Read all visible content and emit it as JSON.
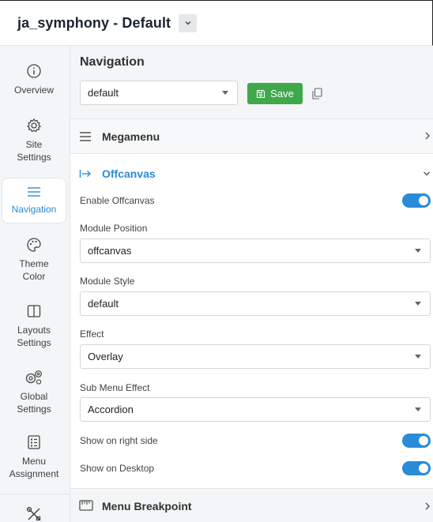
{
  "header": {
    "title": "ja_symphony - Default"
  },
  "sidebar": {
    "items": [
      {
        "label": "Overview"
      },
      {
        "label": "Site Settings"
      },
      {
        "label": "Navigation"
      },
      {
        "label": "Theme Color"
      },
      {
        "label": "Layouts Settings"
      },
      {
        "label": "Global Settings"
      },
      {
        "label": "Menu Assignment"
      }
    ]
  },
  "navigation": {
    "title": "Navigation",
    "preset_select": "default",
    "save_label": "Save"
  },
  "megamenu": {
    "label": "Megamenu"
  },
  "offcanvas": {
    "label": "Offcanvas",
    "enable_label": "Enable Offcanvas",
    "enable_on": true,
    "module_position": {
      "label": "Module Position",
      "value": "offcanvas"
    },
    "module_style": {
      "label": "Module Style",
      "value": "default"
    },
    "effect": {
      "label": "Effect",
      "value": "Overlay"
    },
    "sub_menu_effect": {
      "label": "Sub Menu Effect",
      "value": "Accordion"
    },
    "right_side": {
      "label": "Show on right side",
      "on": true
    },
    "desktop": {
      "label": "Show on Desktop",
      "on": true
    }
  },
  "menu_breakpoint": {
    "label": "Menu Breakpoint"
  },
  "colors": {
    "accent": "#2a8bd6",
    "save": "#3fa84b"
  }
}
